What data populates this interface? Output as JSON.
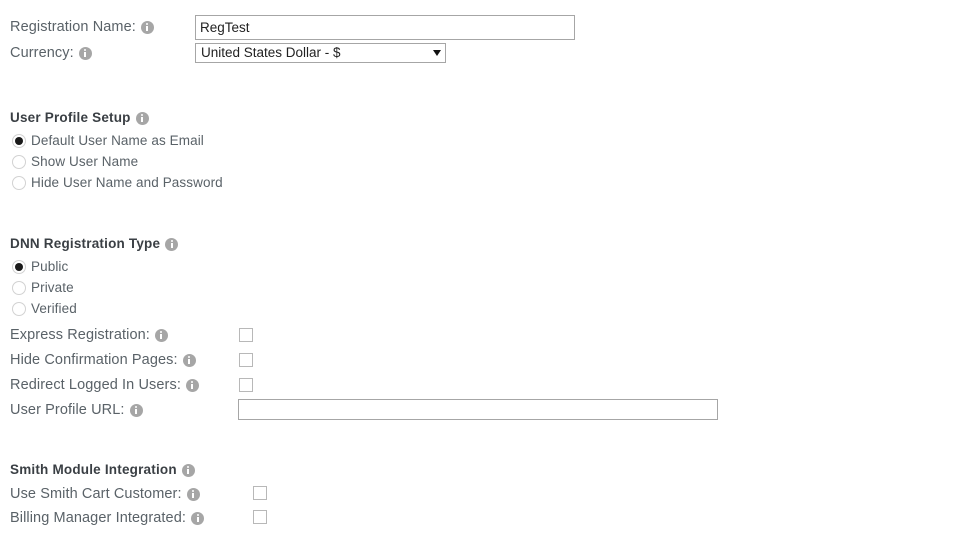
{
  "form": {
    "registration_name": {
      "label": "Registration Name:",
      "value": "RegTest",
      "placeholder": "",
      "info_icon": "info-icon"
    },
    "currency": {
      "label": "Currency:",
      "selected": "United States Dollar - $",
      "options": [
        "United States Dollar - $"
      ],
      "arrow_icon": "chevron-down-icon",
      "info_icon": "info-icon"
    },
    "user_profile_setup": {
      "heading": "User Profile Setup",
      "info_icon": "info-icon",
      "options": [
        {
          "label": "Default User Name as Email",
          "checked": true
        },
        {
          "label": "Show User Name",
          "checked": false
        },
        {
          "label": "Hide User Name and Password",
          "checked": false
        }
      ]
    },
    "dnn_registration_type": {
      "heading": "DNN Registration Type",
      "info_icon": "info-icon",
      "options": [
        {
          "label": "Public",
          "checked": true
        },
        {
          "label": "Private",
          "checked": false
        },
        {
          "label": "Verified",
          "checked": false
        }
      ]
    },
    "express_registration": {
      "label": "Express Registration:",
      "checked": false,
      "info_icon": "info-icon"
    },
    "hide_confirmation_pages": {
      "label": "Hide Confirmation Pages:",
      "checked": false,
      "info_icon": "info-icon"
    },
    "redirect_logged_in_users": {
      "label": "Redirect Logged In Users:",
      "checked": false,
      "info_icon": "info-icon"
    },
    "user_profile_url": {
      "label": "User Profile URL:",
      "value": "",
      "placeholder": "",
      "info_icon": "info-icon"
    },
    "smith_module_integration": {
      "heading": "Smith Module Integration",
      "info_icon": "info-icon",
      "use_smith_cart_customer": {
        "label": "Use Smith Cart Customer:",
        "checked": false,
        "info_icon": "info-icon"
      },
      "billing_manager_integrated": {
        "label": "Billing Manager Integrated:",
        "checked": false,
        "info_icon": "info-icon"
      }
    }
  },
  "colors": {
    "background": "#ffffff",
    "label_text": "#5a6268",
    "heading_text": "#3a3f44",
    "input_border": "#a6a6a6",
    "control_border": "#b8b8b8",
    "radio_ring": "#d2d2d2",
    "radio_dot": "#1a1a1a",
    "info_icon": "#a6a6a6"
  }
}
